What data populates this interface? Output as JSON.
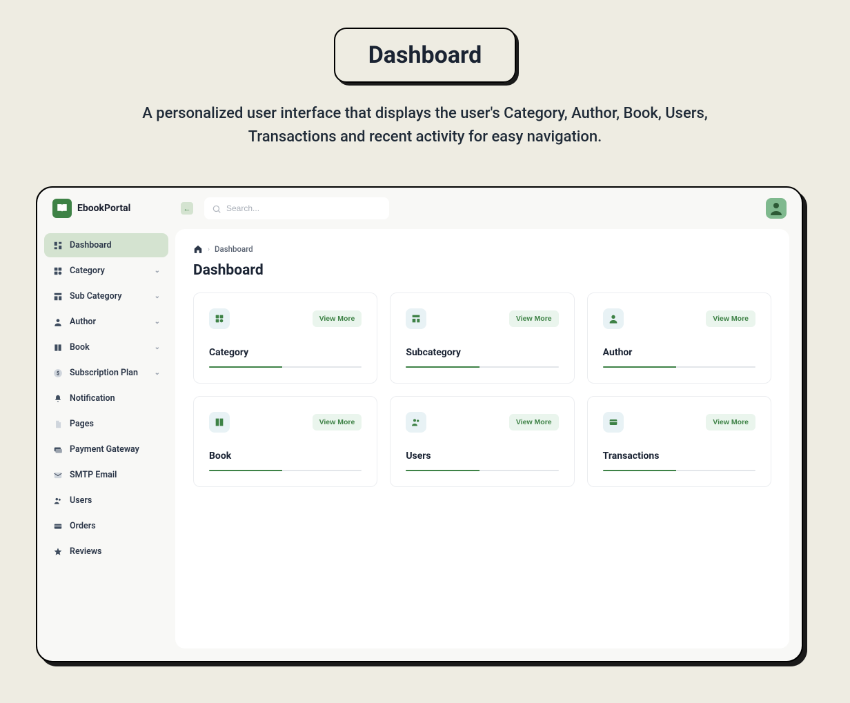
{
  "outer": {
    "title": "Dashboard",
    "subtitle": "A personalized user interface that displays the user's Category, Author, Book, Users, Transactions and recent activity for easy navigation."
  },
  "brand": {
    "name": "EbookPortal"
  },
  "search": {
    "placeholder": "Search..."
  },
  "sidebar": {
    "items": [
      {
        "label": "Dashboard",
        "expandable": false,
        "active": true
      },
      {
        "label": "Category",
        "expandable": true,
        "active": false
      },
      {
        "label": "Sub Category",
        "expandable": true,
        "active": false
      },
      {
        "label": "Author",
        "expandable": true,
        "active": false
      },
      {
        "label": "Book",
        "expandable": true,
        "active": false
      },
      {
        "label": "Subscription Plan",
        "expandable": true,
        "active": false
      },
      {
        "label": "Notification",
        "expandable": false,
        "active": false
      },
      {
        "label": "Pages",
        "expandable": false,
        "active": false
      },
      {
        "label": "Payment Gateway",
        "expandable": false,
        "active": false
      },
      {
        "label": "SMTP Email",
        "expandable": false,
        "active": false
      },
      {
        "label": "Users",
        "expandable": false,
        "active": false
      },
      {
        "label": "Orders",
        "expandable": false,
        "active": false
      },
      {
        "label": "Reviews",
        "expandable": false,
        "active": false
      }
    ]
  },
  "breadcrumb": {
    "current": "Dashboard"
  },
  "main": {
    "title": "Dashboard"
  },
  "cards": [
    {
      "title": "Category",
      "button": "View More",
      "progress": 48
    },
    {
      "title": "Subcategory",
      "button": "View More",
      "progress": 48
    },
    {
      "title": "Author",
      "button": "View More",
      "progress": 48
    },
    {
      "title": "Book",
      "button": "View More",
      "progress": 48
    },
    {
      "title": "Users",
      "button": "View More",
      "progress": 48
    },
    {
      "title": "Transactions",
      "button": "View More",
      "progress": 48
    }
  ]
}
